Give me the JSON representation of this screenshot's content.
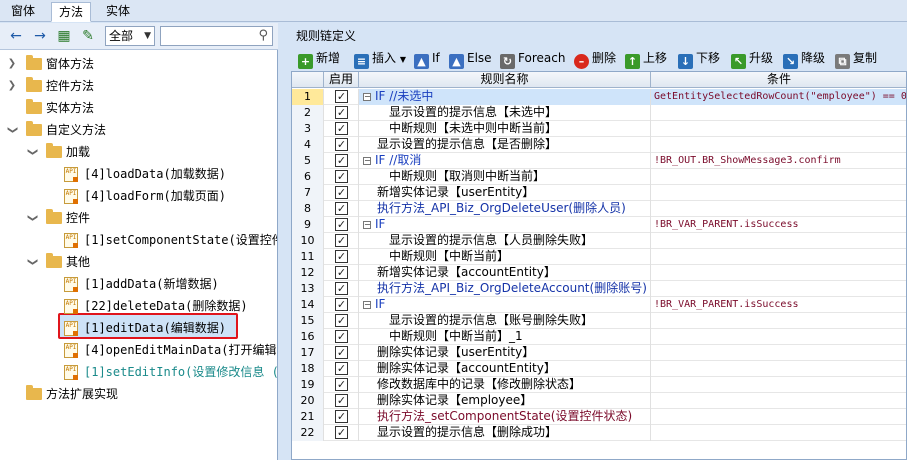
{
  "top_tabs": [
    "窗体",
    "方法",
    "实体"
  ],
  "left": {
    "scope_select": "全部",
    "search_placeholder": "",
    "tree": [
      {
        "level": 0,
        "expanded": false,
        "type": "folder",
        "label": "窗体方法"
      },
      {
        "level": 0,
        "expanded": false,
        "type": "folder",
        "label": "控件方法"
      },
      {
        "level": 0,
        "expanded": null,
        "type": "folder",
        "label": "实体方法"
      },
      {
        "level": 0,
        "expanded": true,
        "type": "folder",
        "label": "自定义方法"
      },
      {
        "level": 1,
        "expanded": true,
        "type": "folder",
        "label": "加载"
      },
      {
        "level": 2,
        "type": "api",
        "label": "[4]loadData(加载数据)"
      },
      {
        "level": 2,
        "type": "api",
        "label": "[4]loadForm(加载页面)"
      },
      {
        "level": 1,
        "expanded": true,
        "type": "folder",
        "label": "控件"
      },
      {
        "level": 2,
        "type": "api",
        "label": "[1]setComponentState(设置控件状"
      },
      {
        "level": 1,
        "expanded": true,
        "type": "folder",
        "label": "其他"
      },
      {
        "level": 2,
        "type": "api",
        "label": "[1]addData(新增数据)"
      },
      {
        "level": 2,
        "type": "api",
        "label": "[22]deleteData(删除数据)",
        "selected": true
      },
      {
        "level": 2,
        "type": "api",
        "label": "[1]editData(编辑数据)"
      },
      {
        "level": 2,
        "type": "api",
        "label": "[4]openEditMainData(打开编辑主数"
      },
      {
        "level": 2,
        "type": "api",
        "label": "[1]setEditInfo(设置修改信息 (编",
        "teal": true
      },
      {
        "level": 0,
        "expanded": null,
        "type": "folder",
        "label": "方法扩展实现"
      }
    ]
  },
  "right": {
    "title": "规则链定义",
    "toolbar": [
      {
        "label": "新增",
        "icon": "plus-icon",
        "color": "#3a9a2a"
      },
      {
        "label": "插入",
        "icon": "insert-icon",
        "color": "#2a6fb8"
      },
      {
        "label": "If",
        "icon": "if-icon",
        "color": "#3b6fc0"
      },
      {
        "label": "Else",
        "icon": "else-icon",
        "color": "#3b6fc0"
      },
      {
        "label": "Foreach",
        "icon": "foreach-icon",
        "color": "#6a6a6a"
      },
      {
        "label": "删除",
        "icon": "delete-icon",
        "color": "#d9281c"
      },
      {
        "label": "上移",
        "icon": "up-icon",
        "color": "#3a9a2a"
      },
      {
        "label": "下移",
        "icon": "down-icon",
        "color": "#2a6fb8"
      },
      {
        "label": "升级",
        "icon": "upgrade-icon",
        "color": "#3a9a2a"
      },
      {
        "label": "降级",
        "icon": "downgrade-icon",
        "color": "#2a6fb8"
      },
      {
        "label": "复制",
        "icon": "copy-icon",
        "color": "#7a7a7a"
      }
    ],
    "columns": [
      "启用",
      "规则名称",
      "条件"
    ],
    "rows": [
      {
        "n": "1",
        "indent": 0,
        "exp": "-",
        "name": "IF //未选中",
        "style": "kw",
        "cond": "GetEntitySelectedRowCount(\"employee\") == 0"
      },
      {
        "n": "2",
        "indent": 2,
        "name": "显示设置的提示信息【未选中】",
        "cond": ""
      },
      {
        "n": "3",
        "indent": 2,
        "name": "中断规则【未选中则中断当前】",
        "cond": ""
      },
      {
        "n": "4",
        "indent": 1,
        "name": "显示设置的提示信息【是否删除】",
        "cond": ""
      },
      {
        "n": "5",
        "indent": 0,
        "exp": "-",
        "name": "IF //取消",
        "style": "kw",
        "cond": "!BR_OUT.BR_ShowMessage3.confirm"
      },
      {
        "n": "6",
        "indent": 2,
        "name": "中断规则【取消则中断当前】",
        "cond": ""
      },
      {
        "n": "7",
        "indent": 1,
        "name": "新增实体记录【userEntity】",
        "cond": ""
      },
      {
        "n": "8",
        "indent": 1,
        "name": "执行方法_API_Biz_OrgDeleteUser(删除人员)",
        "style": "blue",
        "cond": ""
      },
      {
        "n": "9",
        "indent": 0,
        "exp": "-",
        "name": "IF",
        "style": "kw",
        "cond": "!BR_VAR_PARENT.isSuccess"
      },
      {
        "n": "10",
        "indent": 2,
        "name": "显示设置的提示信息【人员删除失败】",
        "cond": ""
      },
      {
        "n": "11",
        "indent": 2,
        "name": "中断规则【中断当前】",
        "cond": ""
      },
      {
        "n": "12",
        "indent": 1,
        "name": "新增实体记录【accountEntity】",
        "cond": ""
      },
      {
        "n": "13",
        "indent": 1,
        "name": "执行方法_API_Biz_OrgDeleteAccount(删除账号)",
        "style": "blue",
        "cond": ""
      },
      {
        "n": "14",
        "indent": 0,
        "exp": "-",
        "name": "IF",
        "style": "kw",
        "cond": "!BR_VAR_PARENT.isSuccess"
      },
      {
        "n": "15",
        "indent": 2,
        "name": "显示设置的提示信息【账号删除失败】",
        "cond": ""
      },
      {
        "n": "16",
        "indent": 2,
        "name": "中断规则【中断当前】_1",
        "cond": ""
      },
      {
        "n": "17",
        "indent": 1,
        "name": "删除实体记录【userEntity】",
        "cond": ""
      },
      {
        "n": "18",
        "indent": 1,
        "name": "删除实体记录【accountEntity】",
        "cond": ""
      },
      {
        "n": "19",
        "indent": 1,
        "name": "修改数据库中的记录【修改删除状态】",
        "cond": ""
      },
      {
        "n": "20",
        "indent": 1,
        "name": "删除实体记录【employee】",
        "cond": ""
      },
      {
        "n": "21",
        "indent": 1,
        "name": "执行方法_setComponentState(设置控件状态)",
        "style": "red",
        "cond": ""
      },
      {
        "n": "22",
        "indent": 1,
        "name": "显示设置的提示信息【删除成功】",
        "cond": ""
      }
    ]
  }
}
